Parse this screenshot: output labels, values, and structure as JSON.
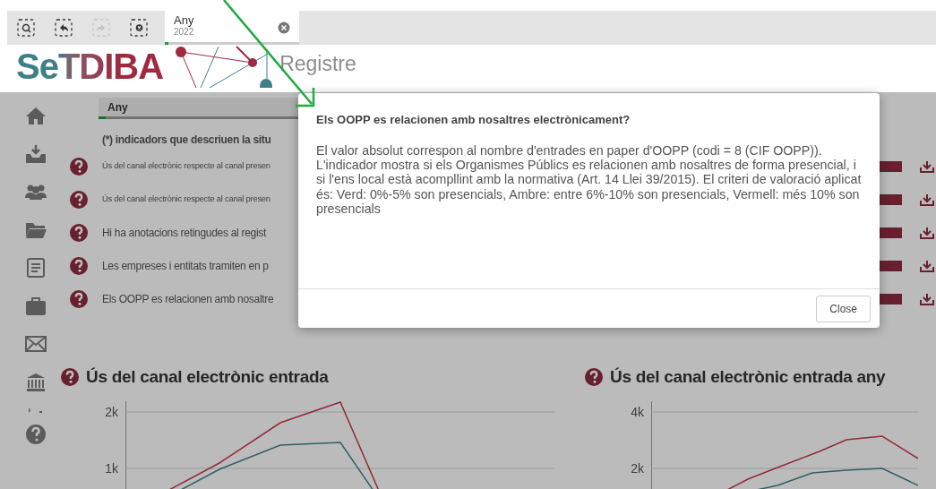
{
  "toolbar": {
    "buttons": [
      {
        "kind": "search",
        "disabled": false
      },
      {
        "kind": "back",
        "disabled": false
      },
      {
        "kind": "forward",
        "disabled": true
      },
      {
        "kind": "clear",
        "disabled": false
      }
    ]
  },
  "selection_tab": {
    "label": "Any",
    "value": "2022"
  },
  "header": {
    "logo": "SeTDIBA",
    "title": "Registre"
  },
  "sidebar": {
    "items": [
      {
        "kind": "home"
      },
      {
        "kind": "inbox"
      },
      {
        "kind": "users"
      },
      {
        "kind": "folder"
      },
      {
        "kind": "document"
      },
      {
        "kind": "briefcase"
      },
      {
        "kind": "mail"
      },
      {
        "kind": "bank"
      },
      {
        "kind": "partial"
      },
      {
        "kind": "help"
      }
    ]
  },
  "filter": {
    "label": "Any"
  },
  "note": "(*) indicadors que descriuen la situ",
  "indicators": [
    {
      "text": "Ús del canal electrònic respecte al canal presen",
      "kind": "small"
    },
    {
      "text": "Ús del canal electrònic respecte al canal presen",
      "kind": "small"
    },
    {
      "text": "Hi ha anotacions retingudes al regist",
      "kind": "large"
    },
    {
      "text": "Les empreses i entitats tramiten en p",
      "kind": "large"
    },
    {
      "text": "Els OOPP es relacionen amb nosaltre",
      "kind": "large"
    }
  ],
  "charts": [
    {
      "title": "Ús del canal electrònic entrada",
      "y_labels": [
        "2k",
        "1k"
      ]
    },
    {
      "title": "Ús del canal electrònic entrada any",
      "y_labels": [
        "4k",
        "2k"
      ]
    }
  ],
  "dialog": {
    "title": "Els OOPP es relacionen amb nosaltres electrònicament?",
    "body": "El valor absolut correspon al nombre d'entrades en paper d'OOPP (codi = 8 (CIF OOPP)). L'indicador mostra si els Organismes Públics es relacionen amb nosaltres de forma presencial, i si l'ens local està acompllint amb la normativa (Art. 14 Llei 39/2015). El criteri de valoració aplicat és: Verd: 0%-5% son presencials, Ambre: entre 6%-10% son presencials, Vermell: més 10% son presencials",
    "buttons": [
      "Close"
    ]
  }
}
